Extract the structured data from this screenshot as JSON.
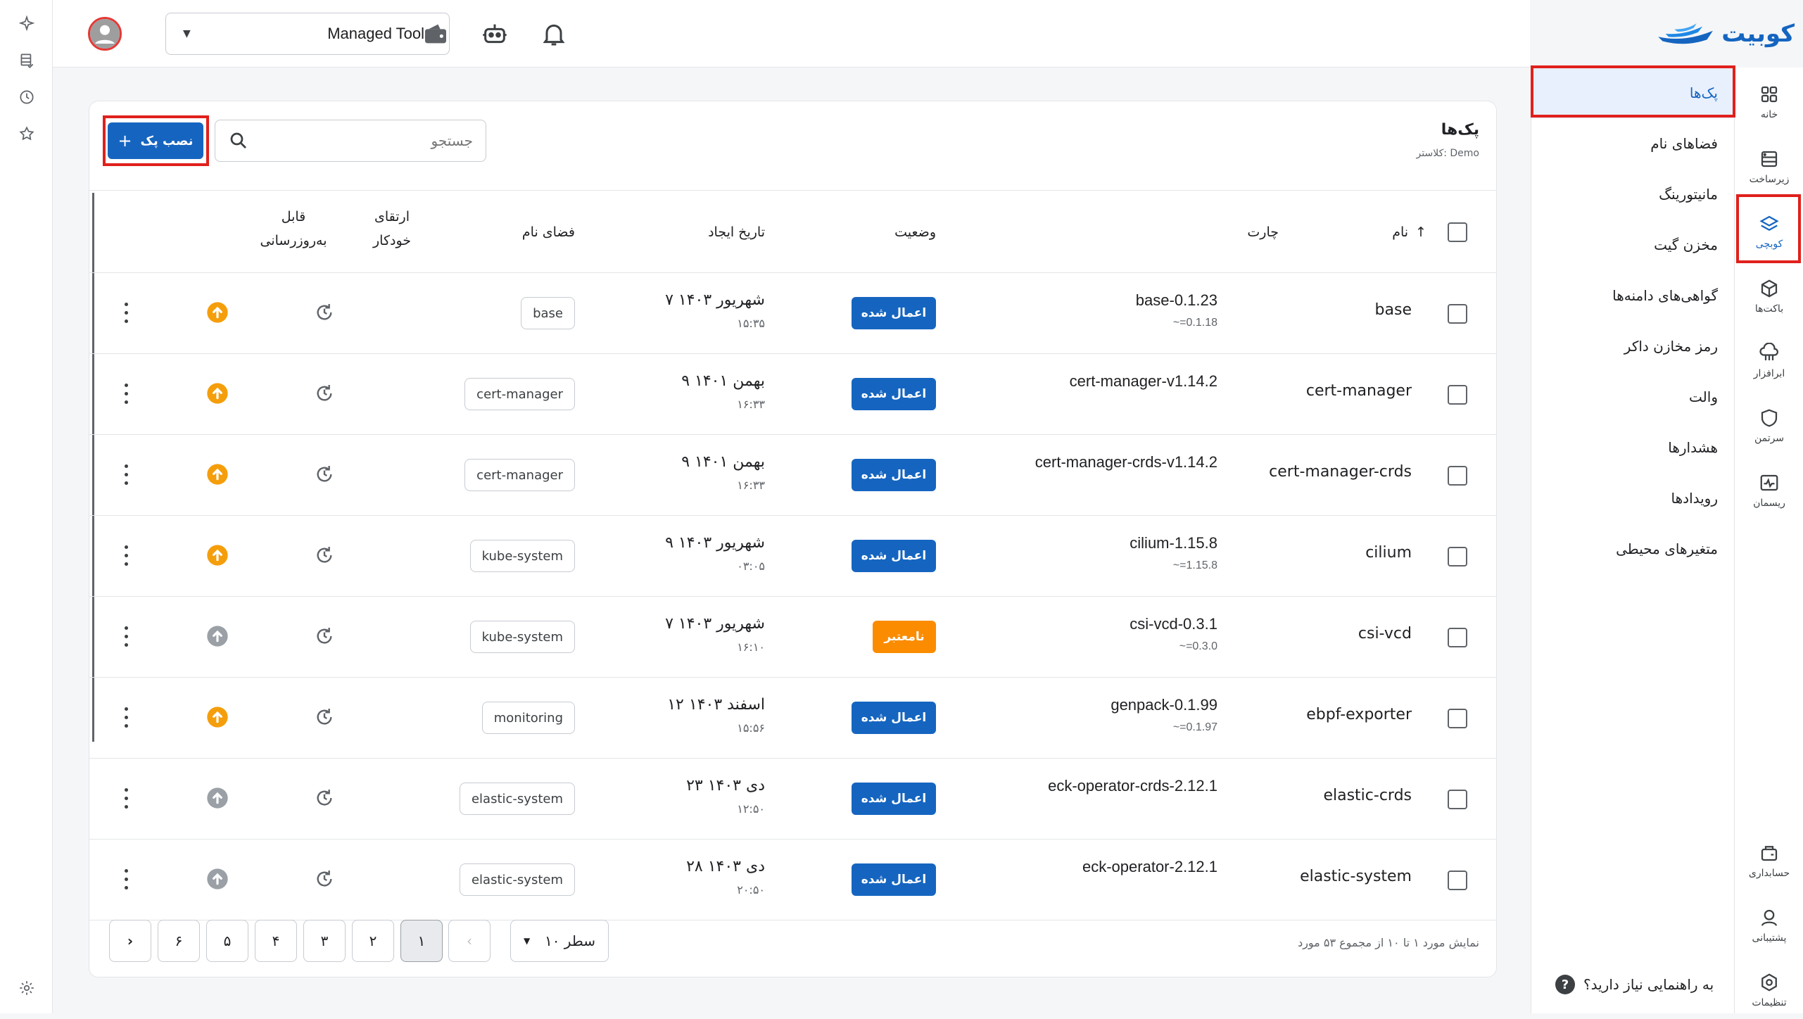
{
  "brand": {
    "name": "کوبیت"
  },
  "topbar": {
    "project_name": "Managed Tools"
  },
  "right_rail": [
    {
      "label": "خانه",
      "icon": "grid-icon"
    },
    {
      "label": "زیرساخت",
      "icon": "server-icon"
    },
    {
      "label": "کوبچی",
      "icon": "layers-icon",
      "active": true
    },
    {
      "label": "باکت‌ها",
      "icon": "cube-icon"
    },
    {
      "label": "ابرافزار",
      "icon": "cloud-app-icon"
    },
    {
      "label": "سرتمن",
      "icon": "shield-icon"
    },
    {
      "label": "ریسمان",
      "icon": "pulse-icon"
    },
    {
      "label": "حسابداری",
      "icon": "wallet-icon"
    },
    {
      "label": "پشتیبانی",
      "icon": "support-icon"
    },
    {
      "label": "تنظیمات",
      "icon": "settings-icon"
    }
  ],
  "side_menu": [
    {
      "label": "پک‌ها",
      "active": true
    },
    {
      "label": "فضاهای نام"
    },
    {
      "label": "مانیتورینگ"
    },
    {
      "label": "مخزن گیت"
    },
    {
      "label": "گواهی‌های دامنه‌ها"
    },
    {
      "label": "رمز مخازن داکر"
    },
    {
      "label": "والت"
    },
    {
      "label": "هشدارها"
    },
    {
      "label": "رویدادها"
    },
    {
      "label": "متغیرهای محیطی"
    }
  ],
  "help": {
    "label": "به راهنمایی نیاز دارید؟",
    "icon": "?"
  },
  "card": {
    "title": "پک‌ها",
    "subtitle": "کلاستر: Demo",
    "search_placeholder": "جستجو",
    "install_label": "نصب پک"
  },
  "table": {
    "headers": {
      "name": "نام",
      "chart": "چارت",
      "status": "وضعیت",
      "created": "تاریخ ایجاد",
      "namespace": "فضای نام",
      "auto_upgrade_1": "ارتقای",
      "auto_upgrade_2": "خودکار",
      "updatable_1": "قابل",
      "updatable_2": "به‌روزرسانی"
    },
    "rows": [
      {
        "name": "base",
        "chart": "base-0.1.23",
        "chart_sub": "~=0.1.18",
        "status": "اعمال شده",
        "status_type": "ok",
        "date": "۷ شهریور ۱۴۰۳",
        "time": "۱۵:۳۵",
        "namespace": "base",
        "updatable": true
      },
      {
        "name": "cert-manager",
        "chart": "cert-manager-v1.14.2",
        "chart_sub": "",
        "status": "اعمال شده",
        "status_type": "ok",
        "date": "۹ بهمن ۱۴۰۱",
        "time": "۱۶:۳۳",
        "namespace": "cert-manager",
        "updatable": true
      },
      {
        "name": "cert-manager-crds",
        "chart": "cert-manager-crds-v1.14.2",
        "chart_sub": "",
        "status": "اعمال شده",
        "status_type": "ok",
        "date": "۹ بهمن ۱۴۰۱",
        "time": "۱۶:۳۳",
        "namespace": "cert-manager",
        "updatable": true
      },
      {
        "name": "cilium",
        "chart": "cilium-1.15.8",
        "chart_sub": "~=1.15.8",
        "status": "اعمال شده",
        "status_type": "ok",
        "date": "۹ شهریور ۱۴۰۳",
        "time": "۰۳:۰۵",
        "namespace": "kube-system",
        "updatable": true
      },
      {
        "name": "csi-vcd",
        "chart": "csi-vcd-0.3.1",
        "chart_sub": "~=0.3.0",
        "status": "نامعتبر",
        "status_type": "bad",
        "date": "۷ شهریور ۱۴۰۳",
        "time": "۱۶:۱۰",
        "namespace": "kube-system",
        "updatable": false
      },
      {
        "name": "ebpf-exporter",
        "chart": "genpack-0.1.99",
        "chart_sub": "~=0.1.97",
        "status": "اعمال شده",
        "status_type": "ok",
        "date": "۱۲ اسفند ۱۴۰۳",
        "time": "۱۵:۵۶",
        "namespace": "monitoring",
        "updatable": true
      },
      {
        "name": "elastic-crds",
        "chart": "eck-operator-crds-2.12.1",
        "chart_sub": "",
        "status": "اعمال شده",
        "status_type": "ok",
        "date": "۲۳ دی ۱۴۰۳",
        "time": "۱۲:۵۰",
        "namespace": "elastic-system",
        "updatable": false
      },
      {
        "name": "elastic-system",
        "chart": "eck-operator-2.12.1",
        "chart_sub": "",
        "status": "اعمال شده",
        "status_type": "ok",
        "date": "۲۸ دی ۱۴۰۳",
        "time": "۲۰:۵۰",
        "namespace": "elastic-system",
        "updatable": false
      }
    ]
  },
  "pagination": {
    "info": "نمایش مورد ۱ تا ۱۰ از مجموع ۵۳ مورد",
    "rows_per_page": "۱۰ سطر",
    "pages": [
      "۱",
      "۲",
      "۳",
      "۴",
      "۵",
      "۶"
    ],
    "active_page": "۱",
    "prev": "‹",
    "next": "›"
  },
  "colors": {
    "primary": "#1565c0",
    "warning": "#fb8c00",
    "highlight": "#e0201c",
    "orange_icon": "#f59e0b"
  }
}
